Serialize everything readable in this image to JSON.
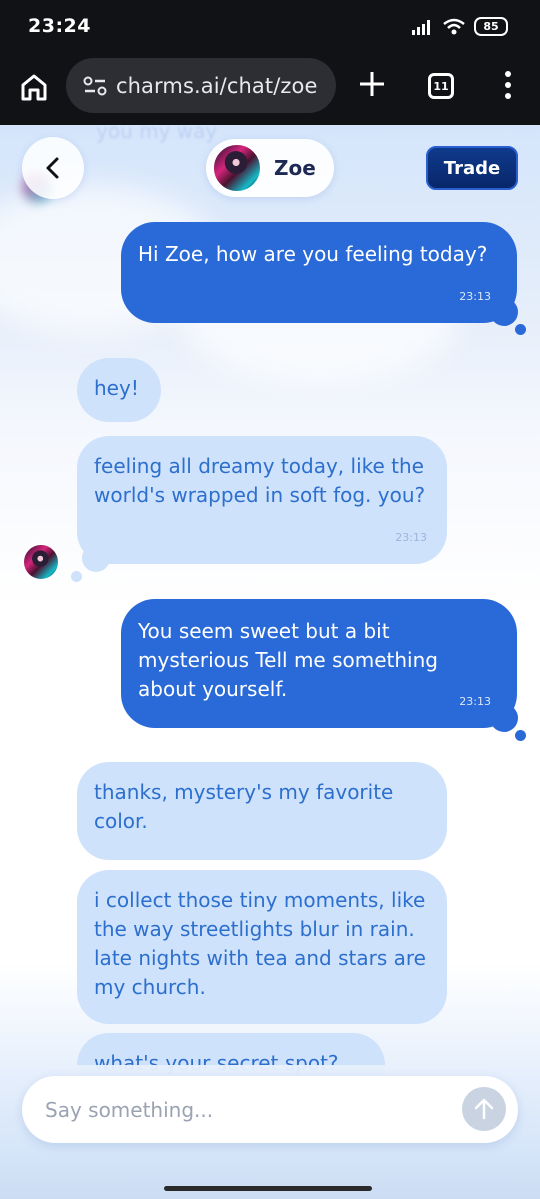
{
  "status_bar": {
    "time": "23:24",
    "battery": "85"
  },
  "browser": {
    "url": "charms.ai/chat/zoe",
    "tab_count": "11"
  },
  "header": {
    "character_name": "Zoe",
    "trade_label": "Trade"
  },
  "ghost_text": "you my way",
  "messages": [
    {
      "sender": "user",
      "text": "Hi Zoe, how are you feeling today?",
      "time": "23:13"
    },
    {
      "sender": "bot",
      "text": "hey!",
      "time": ""
    },
    {
      "sender": "bot",
      "text": "feeling all dreamy today, like the world's wrapped in soft fog. you?",
      "time": "23:13"
    },
    {
      "sender": "user",
      "text": "You seem sweet but a bit mysterious  Tell me something about yourself.",
      "time": "23:13"
    },
    {
      "sender": "bot",
      "text": "thanks, mystery's my favorite color.",
      "time": ""
    },
    {
      "sender": "bot",
      "text": "i collect those tiny moments, like the way streetlights blur in rain. late nights with tea and stars are my church.",
      "time": ""
    },
    {
      "sender": "bot",
      "text": "what's your secret spot?",
      "time": ""
    }
  ],
  "input": {
    "placeholder": "Say something..."
  },
  "colors": {
    "user_bubble": "#2a6ad8",
    "bot_bubble": "#cfe2fb",
    "bot_text": "#2c6fcd",
    "trade_button": "#0f3a8c"
  }
}
